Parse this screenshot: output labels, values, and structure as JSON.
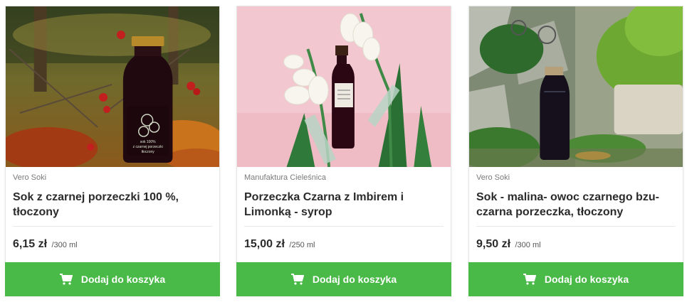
{
  "products": [
    {
      "producer": "Vero Soki",
      "title": "Sok z czarnej porzeczki 100 %, tłoczony",
      "price": "6,15 zł",
      "unit": "/300 ml",
      "button_label": "Dodaj do koszyka",
      "image_icon": "blackcurrant-juice-bottle-autumn-photo",
      "label_lines": [
        "sok 100%",
        "z czarnej porzeczki",
        "tłoczony"
      ]
    },
    {
      "producer": "Manufaktura Cieleśnica",
      "title": "Porzeczka Czarna z Imbirem i Limonką - syrop",
      "price": "15,00 zł",
      "unit": "/250 ml",
      "button_label": "Dodaj do koszyka",
      "image_icon": "syrup-bottle-pink-background-photo"
    },
    {
      "producer": "Vero Soki",
      "title": "Sok - malina- owoc czarnego bzu- czarna porzeczka, tłoczony",
      "price": "9,50 zł",
      "unit": "/300 ml",
      "button_label": "Dodaj do koszyka",
      "image_icon": "juice-bottle-garden-plants-photo"
    }
  ],
  "colors": {
    "button_bg": "#49b947",
    "button_text": "#ffffff",
    "title_text": "#2b2b2b",
    "producer_text": "#7a7a7a"
  },
  "icons": {
    "cart": "cart-icon"
  }
}
